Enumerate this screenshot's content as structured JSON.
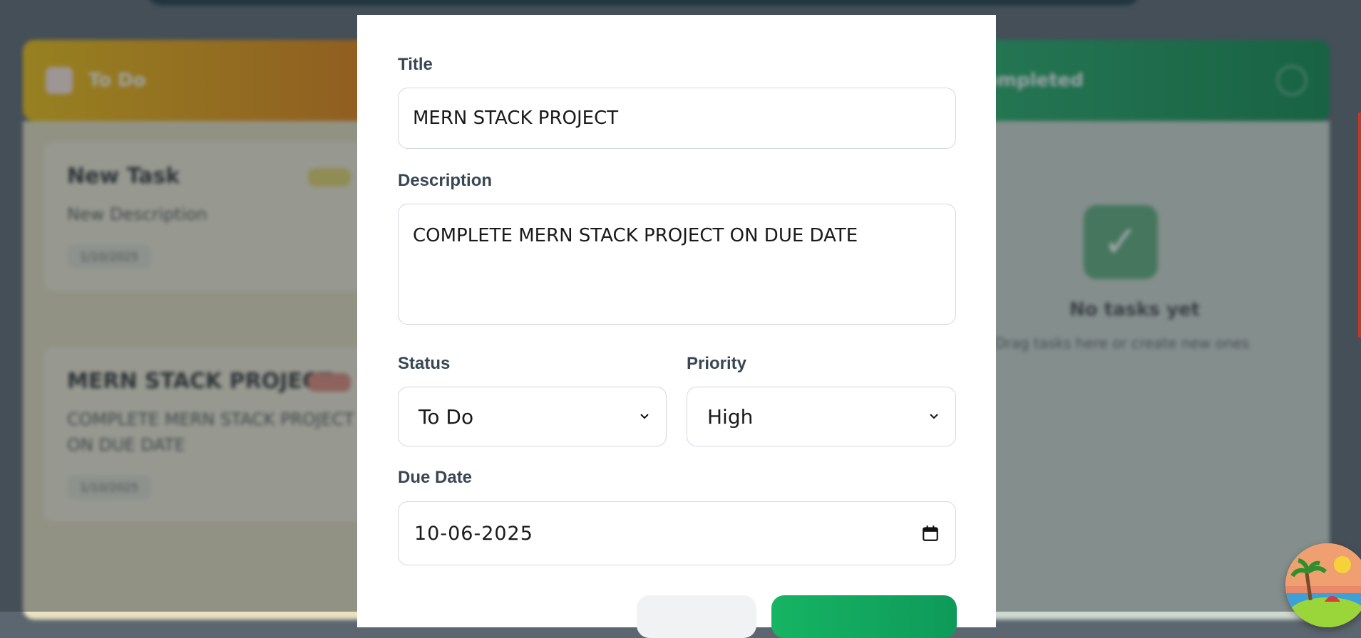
{
  "background": {
    "todo_column": {
      "title": "To Do"
    },
    "completed_column": {
      "title": "Completed"
    },
    "cards": [
      {
        "title": "New Task",
        "description": "New Description",
        "chip": "1/10/2025"
      },
      {
        "title": "MERN STACK PROJECT",
        "description": "COMPLETE MERN STACK PROJECT ON DUE DATE",
        "chip": "1/10/2025"
      }
    ],
    "empty": {
      "title": "No tasks yet",
      "subtitle": "Drag tasks here or create new ones"
    }
  },
  "form": {
    "title_label": "Title",
    "title_value": "MERN STACK PROJECT",
    "description_label": "Description",
    "description_value": "COMPLETE MERN STACK PROJECT ON DUE DATE",
    "status_label": "Status",
    "status_value": "To Do",
    "priority_label": "Priority",
    "priority_value": "High",
    "due_label": "Due Date",
    "due_value": "10-06-2025"
  },
  "colors": {
    "accent_green": "#16b463",
    "todo_header": "#f2c10c",
    "completed_header": "#25b06a"
  }
}
